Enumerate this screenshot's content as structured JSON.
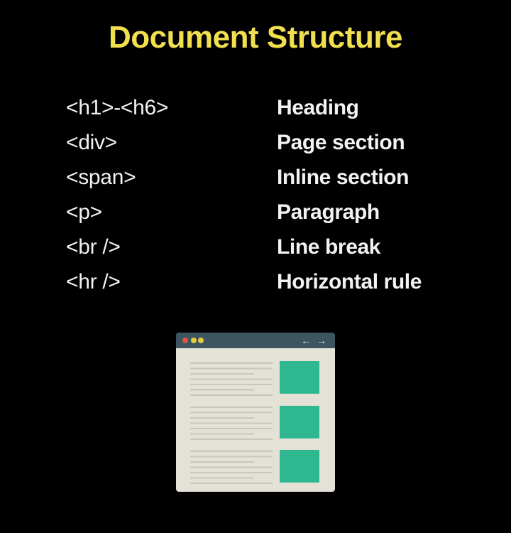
{
  "title": "Document Structure",
  "rows": [
    {
      "tag": "<h1>-<h6>",
      "desc": "Heading"
    },
    {
      "tag": "<div>",
      "desc": "Page section"
    },
    {
      "tag": "<span>",
      "desc": "Inline section"
    },
    {
      "tag": "<p>",
      "desc": "Paragraph"
    },
    {
      "tag": "<br />",
      "desc": "Line break"
    },
    {
      "tag": "<hr />",
      "desc": "Horizontal rule"
    }
  ],
  "illustration": {
    "nav_arrows": "← →",
    "icons": [
      "browser-window-icon",
      "window-dot-icon",
      "nav-arrows-icon"
    ]
  },
  "colors": {
    "background": "#000000",
    "title": "#f2df4f",
    "text": "#f2f2f2",
    "browser_bar": "#3d5560",
    "browser_body": "#e4e2d6",
    "dot_red": "#e05540",
    "dot_yellow": "#e8c840",
    "text_line": "#c9c7bc",
    "block": "#2fb890"
  }
}
